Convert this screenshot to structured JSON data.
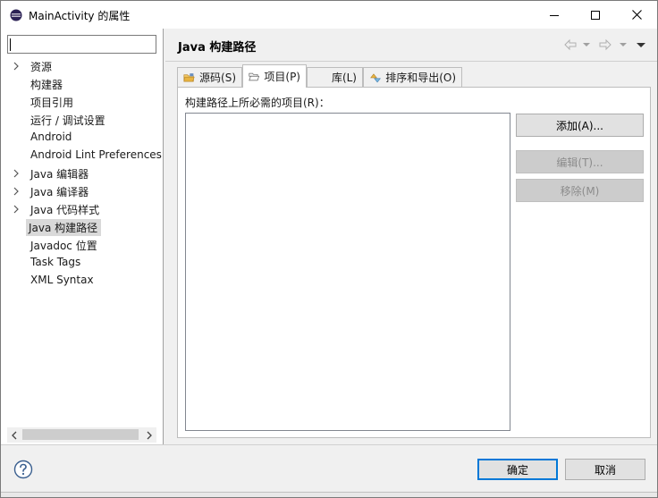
{
  "window": {
    "title": "MainActivity 的属性",
    "controls": {
      "minimize": "minimize",
      "maximize": "maximize",
      "close": "close"
    }
  },
  "filter": {
    "value": "",
    "placeholder": ""
  },
  "tree": {
    "items": [
      {
        "label": "资源",
        "expandable": true,
        "selected": false
      },
      {
        "label": "构建器",
        "expandable": false,
        "selected": false
      },
      {
        "label": "项目引用",
        "expandable": false,
        "selected": false
      },
      {
        "label": "运行 / 调试设置",
        "expandable": false,
        "selected": false
      },
      {
        "label": "Android",
        "expandable": false,
        "selected": false
      },
      {
        "label": "Android Lint Preferences",
        "expandable": false,
        "selected": false
      },
      {
        "label": "Java 编辑器",
        "expandable": true,
        "selected": false
      },
      {
        "label": "Java 编译器",
        "expandable": true,
        "selected": false
      },
      {
        "label": "Java 代码样式",
        "expandable": true,
        "selected": false
      },
      {
        "label": "Java 构建路径",
        "expandable": false,
        "selected": true
      },
      {
        "label": "Javadoc 位置",
        "expandable": false,
        "selected": false
      },
      {
        "label": "Task Tags",
        "expandable": false,
        "selected": false
      },
      {
        "label": "XML Syntax",
        "expandable": false,
        "selected": false
      }
    ]
  },
  "page": {
    "title": "Java 构建路径"
  },
  "tabs": [
    {
      "label": "源码(S)",
      "icon": "source-folder-icon",
      "active": false
    },
    {
      "label": "项目(P)",
      "icon": "open-folder-icon",
      "active": true
    },
    {
      "label": "库(L)",
      "icon": "library-icon",
      "active": false
    },
    {
      "label": "排序和导出(O)",
      "icon": "order-export-icon",
      "active": false
    }
  ],
  "content": {
    "label": "构建路径上所必需的项目(R)："
  },
  "buttons": {
    "add": "添加(A)...",
    "edit": "编辑(T)...",
    "remove": "移除(M)"
  },
  "footer": {
    "ok": "确定",
    "cancel": "取消"
  },
  "colors": {
    "accent": "#0078d7",
    "tab_icon_folder": "#e8b441"
  }
}
